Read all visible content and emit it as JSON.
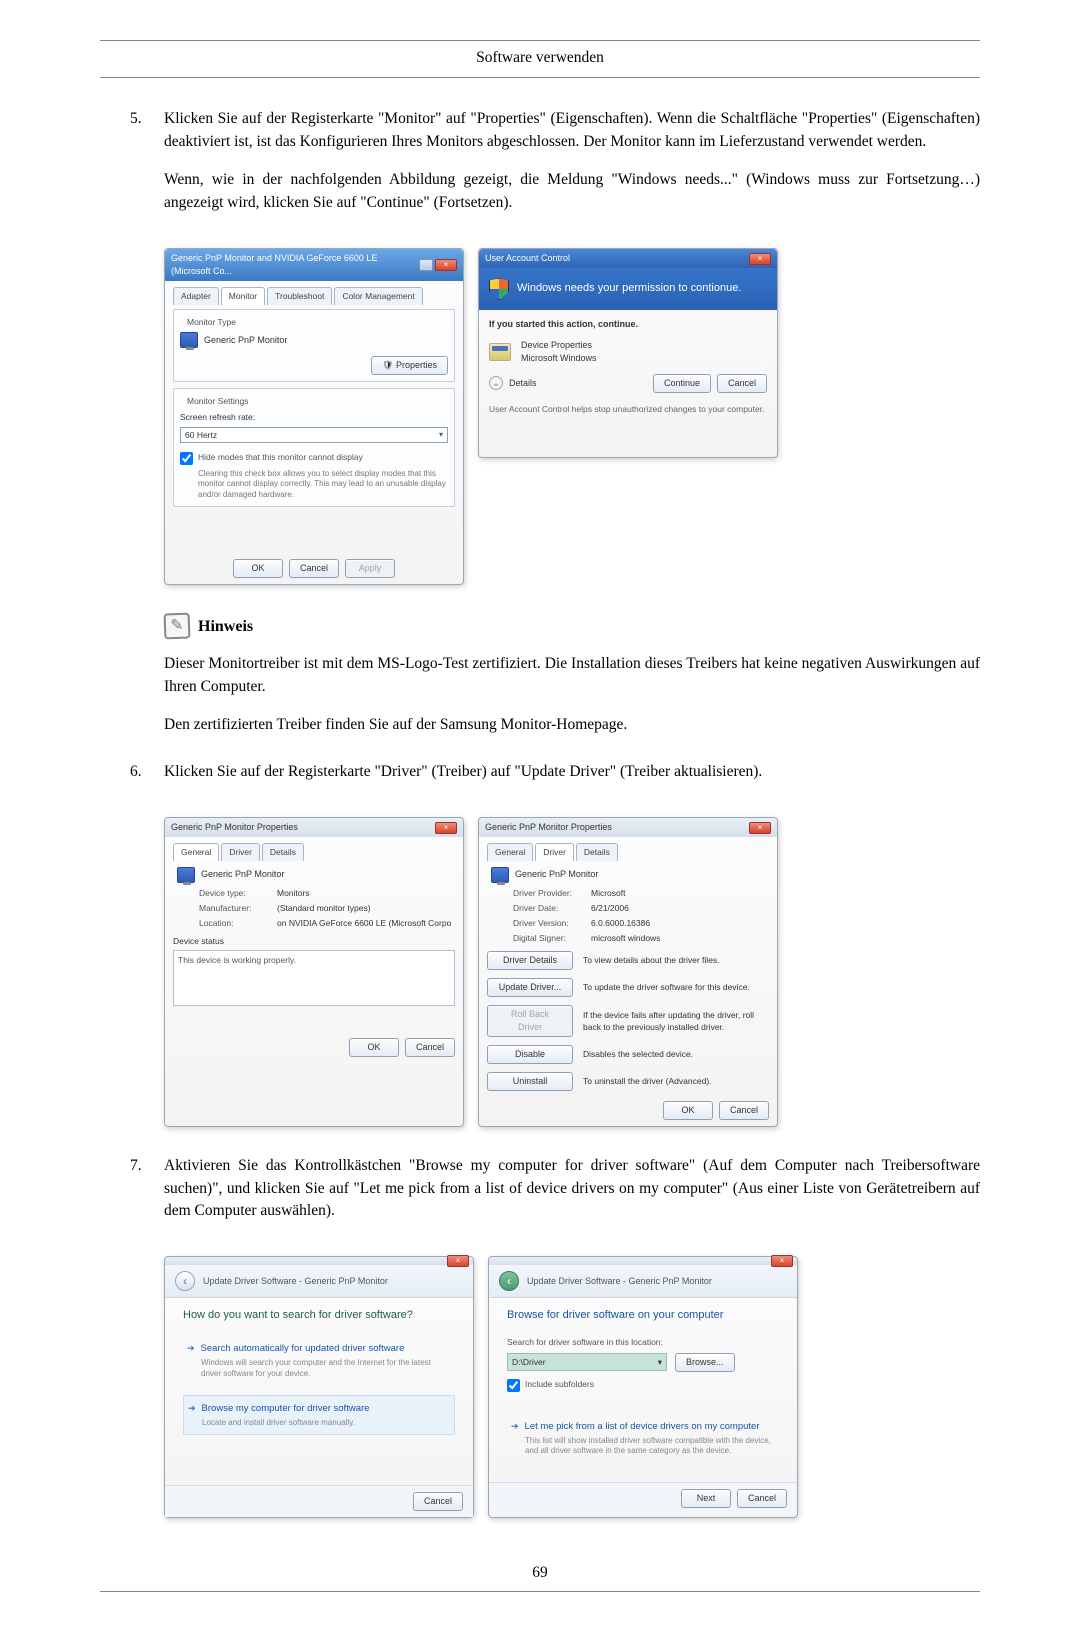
{
  "page_header": "Software verwenden",
  "page_number": "69",
  "steps": {
    "s5_num": "5.",
    "s5_p1": "Klicken Sie auf der Registerkarte \"Monitor\" auf \"Properties\" (Eigenschaften). Wenn die Schaltfläche \"Properties\" (Eigenschaften) deaktiviert ist, ist das Konfigurieren Ihres Monitors abgeschlossen. Der Monitor kann im Lieferzustand verwendet werden.",
    "s5_p2": "Wenn, wie in der nachfolgenden Abbildung gezeigt, die Meldung \"Windows needs...\" (Windows muss zur Fortsetzung…) angezeigt wird, klicken Sie auf \"Continue\" (Fortsetzen).",
    "s6_num": "6.",
    "s6_p1": "Klicken Sie auf der Registerkarte \"Driver\" (Treiber) auf \"Update Driver\" (Treiber aktualisieren).",
    "s7_num": "7.",
    "s7_p1": "Aktivieren Sie das Kontrollkästchen \"Browse my computer for driver software\" (Auf dem Computer nach Treibersoftware suchen)\", und klicken Sie auf \"Let me pick from a list of device drivers on my computer\" (Aus einer Liste von Gerätetreibern auf dem Computer auswählen)."
  },
  "note": {
    "title": "Hinweis",
    "p1": "Dieser Monitortreiber ist mit dem MS-Logo-Test zertifiziert. Die Installation dieses Treibers hat keine negativen Auswirkungen auf Ihren Computer.",
    "p2": "Den zertifizierten Treiber finden Sie auf der Samsung Monitor-Homepage."
  },
  "shot1_left": {
    "title": "Generic PnP Monitor and NVIDIA GeForce 6600 LE (Microsoft Co...",
    "tabs": {
      "t1": "Adapter",
      "t2": "Monitor",
      "t3": "Troubleshoot",
      "t4": "Color Management"
    },
    "g1_title": "Monitor Type",
    "monitor_name": "Generic PnP Monitor",
    "properties_btn": "Properties",
    "g2_title": "Monitor Settings",
    "refresh_label": "Screen refresh rate:",
    "refresh_value": "60 Hertz",
    "hide_label": "Hide modes that this monitor cannot display",
    "hide_desc": "Clearing this check box allows you to select display modes that this monitor cannot display correctly. This may lead to an unusable display and/or damaged hardware.",
    "ok": "OK",
    "cancel": "Cancel",
    "apply": "Apply"
  },
  "shot1_right": {
    "title": "User Account Control",
    "headline": "Windows needs your permission to contionue.",
    "if_started": "If you started this action, continue.",
    "prog_name": "Device Properties",
    "prog_pub": "Microsoft Windows",
    "details": "Details",
    "continue": "Continue",
    "cancel": "Cancel",
    "footer": "User Account Control helps stop unauthorized changes to your computer."
  },
  "shot2_left": {
    "title": "Generic PnP Monitor Properties",
    "tabs": {
      "t1": "General",
      "t2": "Driver",
      "t3": "Details"
    },
    "name": "Generic PnP Monitor",
    "kv": {
      "k1": "Device type:",
      "v1": "Monitors",
      "k2": "Manufacturer:",
      "v2": "(Standard monitor types)",
      "k3": "Location:",
      "v3": "on NVIDIA GeForce 6600 LE (Microsoft Corpo"
    },
    "status_label": "Device status",
    "status_text": "This device is working properly.",
    "ok": "OK",
    "cancel": "Cancel"
  },
  "shot2_right": {
    "title": "Generic PnP Monitor Properties",
    "tabs": {
      "t1": "General",
      "t2": "Driver",
      "t3": "Details"
    },
    "name": "Generic PnP Monitor",
    "kv": {
      "k1": "Driver Provider:",
      "v1": "Microsoft",
      "k2": "Driver Date:",
      "v2": "6/21/2006",
      "k3": "Driver Version:",
      "v3": "6.0.6000.16386",
      "k4": "Digital Signer:",
      "v4": "microsoft windows"
    },
    "b1": "Driver Details",
    "d1": "To view details about the driver files.",
    "b2": "Update Driver...",
    "d2": "To update the driver software for this device.",
    "b3": "Roll Back Driver",
    "d3": "If the device fails after updating the driver, roll back to the previously installed driver.",
    "b4": "Disable",
    "d4": "Disables the selected device.",
    "b5": "Uninstall",
    "d5": "To uninstall the driver (Advanced).",
    "ok": "OK",
    "cancel": "Cancel"
  },
  "shot3_left": {
    "crumb": "Update Driver Software - Generic PnP Monitor",
    "heading": "How do you want to search for driver software?",
    "opt1_title": "Search automatically for updated driver software",
    "opt1_sub": "Windows will search your computer and the Internet for the latest driver software for your device.",
    "opt2_title": "Browse my computer for driver software",
    "opt2_sub": "Locate and install driver software manually.",
    "cancel": "Cancel"
  },
  "shot3_right": {
    "crumb": "Update Driver Software - Generic PnP Monitor",
    "heading": "Browse for driver software on your computer",
    "search_label": "Search for driver software in this location:",
    "path_value": "D:\\Driver",
    "browse": "Browse...",
    "include_sub": "Include subfolders",
    "opt_title": "Let me pick from a list of device drivers on my computer",
    "opt_sub": "This list will show installed driver software compatible with the device, and all driver software in the same category as the device.",
    "next": "Next",
    "cancel": "Cancel"
  }
}
